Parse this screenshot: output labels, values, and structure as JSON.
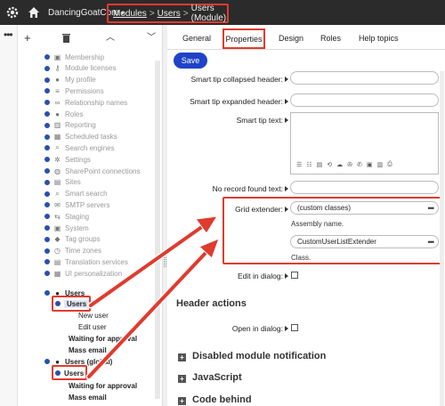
{
  "topbar": {
    "site_name": "DancingGoatCore",
    "site_caret": "▾",
    "breadcrumbs": [
      "Modules",
      "Users",
      "Users (Module)"
    ],
    "separator": ">"
  },
  "tree": {
    "items": [
      {
        "label": "Membership",
        "icon": "group-icon",
        "glyph": "▣"
      },
      {
        "label": "Module licenses",
        "icon": "key-icon",
        "glyph": "⚷"
      },
      {
        "label": "My profile",
        "icon": "user-icon",
        "glyph": "●"
      },
      {
        "label": "Permissions",
        "icon": "list-icon",
        "glyph": "≡"
      },
      {
        "label": "Relationship names",
        "icon": "link-icon",
        "glyph": "∞"
      },
      {
        "label": "Roles",
        "icon": "users-icon",
        "glyph": "●"
      },
      {
        "label": "Reporting",
        "icon": "chart-icon",
        "glyph": "▥"
      },
      {
        "label": "Scheduled tasks",
        "icon": "calendar-icon",
        "glyph": "▦"
      },
      {
        "label": "Search engines",
        "icon": "search-icon",
        "glyph": "⌕"
      },
      {
        "label": "Settings",
        "icon": "cog-icon",
        "glyph": "✲"
      },
      {
        "label": "SharePoint connections",
        "icon": "sharepoint-icon",
        "glyph": "◍"
      },
      {
        "label": "Sites",
        "icon": "sites-icon",
        "glyph": "▤"
      },
      {
        "label": "Smart search",
        "icon": "search-icon",
        "glyph": "⌕"
      },
      {
        "label": "SMTP servers",
        "icon": "mail-icon",
        "glyph": "✉"
      },
      {
        "label": "Staging",
        "icon": "staging-icon",
        "glyph": "⇆"
      },
      {
        "label": "System",
        "icon": "system-icon",
        "glyph": "▣"
      },
      {
        "label": "Tag groups",
        "icon": "tag-icon",
        "glyph": "◆"
      },
      {
        "label": "Time zones",
        "icon": "clock-icon",
        "glyph": "◷"
      },
      {
        "label": "Translation services",
        "icon": "translate-icon",
        "glyph": "▤"
      },
      {
        "label": "UI personalization",
        "icon": "ui-icon",
        "glyph": "▦"
      }
    ],
    "users_group": "Users",
    "users_node": "Users",
    "new_user": "New user",
    "edit_user": "Edit user",
    "waiting_for_approval": "Waiting for approval",
    "mass_email": "Mass email",
    "users_global": "Users (global)",
    "users_node_2": "Users",
    "waiting_for_approval_2": "Waiting for approval",
    "mass_email_2": "Mass email"
  },
  "tabs": [
    "General",
    "Properties",
    "Design",
    "Roles",
    "Help topics"
  ],
  "active_tab": "Properties",
  "save_label": "Save",
  "form": {
    "smart_tip_collapsed": "Smart tip collapsed header:",
    "smart_tip_expanded": "Smart tip expanded header:",
    "smart_tip_text": "Smart tip text:",
    "no_record_found": "No record found text:",
    "grid_extender": "Grid extender:",
    "grid_extender_assembly": "(custom classes)",
    "assembly_help": "Assembly name.",
    "grid_extender_class": "CustomUserListExtender",
    "class_help": "Class.",
    "edit_in_dialog": "Edit in dialog:",
    "header_actions": "Header actions",
    "open_in_dialog": "Open in dialog:",
    "disabled_notification": "Disabled module notification",
    "javascript": "JavaScript",
    "code_behind": "Code behind",
    "more": "•••",
    "editor_toolbar": [
      "☰",
      "☷",
      "▤",
      "⟲",
      "☁",
      "✇",
      "✆",
      "▣",
      "▥",
      "⎙"
    ]
  },
  "colors": {
    "highlight": "#e03b2f",
    "save_button": "#1f43c8",
    "bullet": "#2b4fa8",
    "topbar": "#2b2b2b"
  }
}
